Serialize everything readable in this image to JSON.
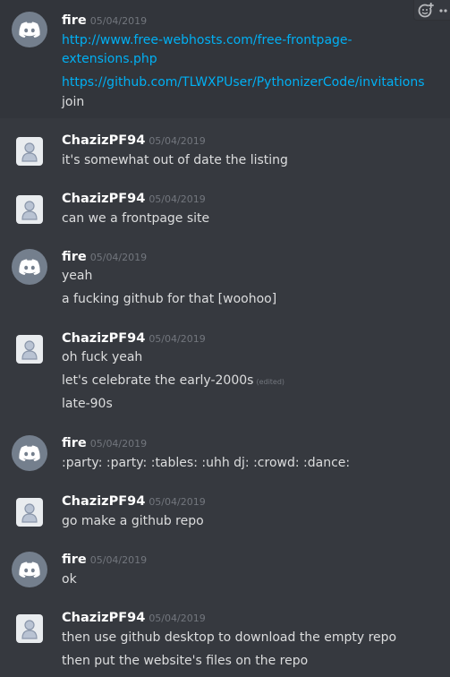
{
  "messages": [
    {
      "author": "fire",
      "timestamp": "05/04/2019",
      "avatar": "discord-default-avatar",
      "lines": [
        {
          "text": "http://www.free-webhosts.com/free-frontpage-",
          "link": true
        },
        {
          "text": "extensions.php",
          "link": true
        },
        {
          "text": "https://github.com/TLWXPUser/PythonizerCode/invitations",
          "link": true
        },
        {
          "text": "join"
        }
      ]
    },
    {
      "author": "ChazizPF94",
      "timestamp": "05/04/2019",
      "avatar": "default-user-avatar",
      "lines": [
        {
          "text": "it's somewhat out of date the listing"
        }
      ]
    },
    {
      "author": "ChazizPF94",
      "timestamp": "05/04/2019",
      "avatar": "default-user-avatar",
      "lines": [
        {
          "text": "can we a frontpage site"
        }
      ]
    },
    {
      "author": "fire",
      "timestamp": "05/04/2019",
      "avatar": "discord-default-avatar",
      "lines": [
        {
          "text": "yeah"
        },
        {
          "text": "a fucking github for that [woohoo]"
        }
      ]
    },
    {
      "author": "ChazizPF94",
      "timestamp": "05/04/2019",
      "avatar": "default-user-avatar",
      "lines": [
        {
          "text": "oh fuck yeah"
        },
        {
          "text": "let's celebrate the early-2000s",
          "edited": "(edited)"
        },
        {
          "text": "late-90s"
        }
      ]
    },
    {
      "author": "fire",
      "timestamp": "05/04/2019",
      "avatar": "discord-default-avatar",
      "lines": [
        {
          "text": ":party: :party: :tables: :uhh dj: :crowd: :dance:"
        }
      ]
    },
    {
      "author": "ChazizPF94",
      "timestamp": "05/04/2019",
      "avatar": "default-user-avatar",
      "lines": [
        {
          "text": "go make a github repo"
        }
      ]
    },
    {
      "author": "fire",
      "timestamp": "05/04/2019",
      "avatar": "discord-default-avatar",
      "lines": [
        {
          "text": "ok"
        }
      ]
    },
    {
      "author": "ChazizPF94",
      "timestamp": "05/04/2019",
      "avatar": "default-user-avatar",
      "lines": [
        {
          "text": "then use github desktop to download the empty repo"
        },
        {
          "text": "then put the website's files on the repo"
        }
      ]
    }
  ],
  "toolbar": {
    "icons": [
      "add-reaction-icon",
      "more-options-icon"
    ]
  },
  "colors": {
    "background": "#36393f",
    "hover_background": "#32353b",
    "username": "#ffffff",
    "timestamp": "#72767d",
    "text": "#dcddde",
    "link": "#00b0f4",
    "discord_avatar": "#747f8d"
  }
}
